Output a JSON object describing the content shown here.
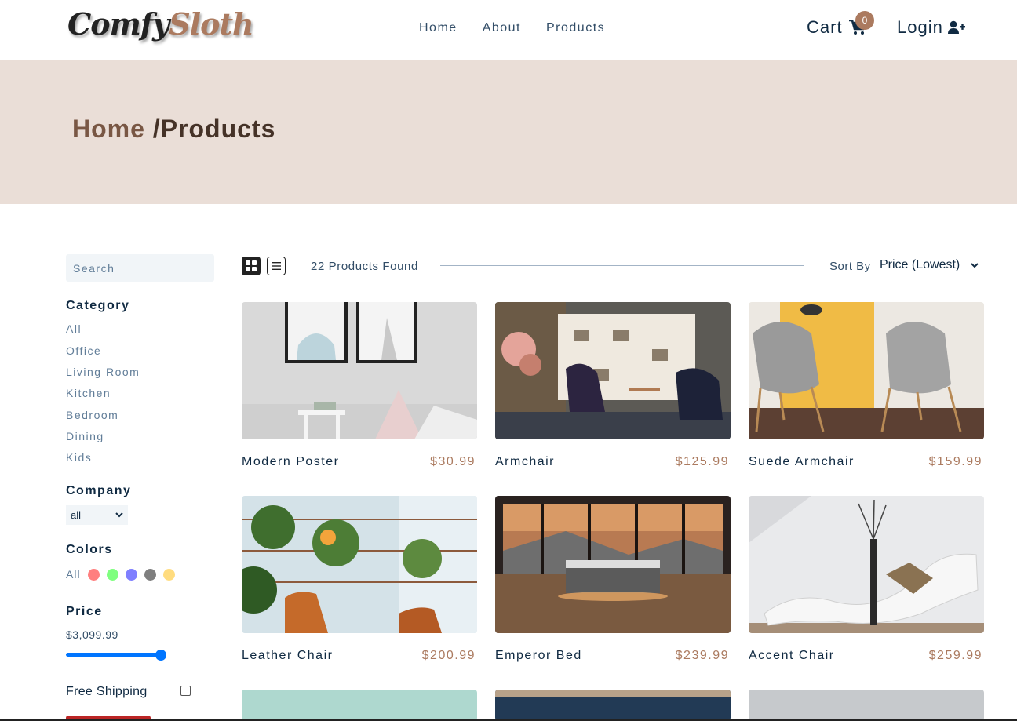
{
  "nav": {
    "logo_part1": "Comfy",
    "logo_part2": "Sloth",
    "links": [
      "Home",
      "About",
      "Products"
    ],
    "cart_label": "Cart",
    "cart_count": "0",
    "login_label": "Login"
  },
  "hero": {
    "crumb_home": "Home",
    "crumb_current": " /Products"
  },
  "filters": {
    "search_placeholder": "Search",
    "category_title": "Category",
    "categories": [
      "All",
      "Office",
      "Living Room",
      "Kitchen",
      "Bedroom",
      "Dining",
      "Kids"
    ],
    "company_title": "Company",
    "company_selected": "all",
    "colors_title": "Colors",
    "colors_all": "All",
    "colors": [
      "#ff0000",
      "#00ff00",
      "#0000ff",
      "#000000",
      "#ffb900"
    ],
    "price_title": "Price",
    "price_value": "$3,099.99",
    "free_shipping_label": "Free Shipping"
  },
  "toolbar": {
    "found": "22 Products Found",
    "sort_label": "Sort By",
    "sort_value": "Price (Lowest)"
  },
  "products": [
    {
      "name": "Modern Poster",
      "price": "$30.99"
    },
    {
      "name": "Armchair",
      "price": "$125.99"
    },
    {
      "name": "Suede Armchair",
      "price": "$159.99"
    },
    {
      "name": "Leather Chair",
      "price": "$200.99"
    },
    {
      "name": "Emperor Bed",
      "price": "$239.99"
    },
    {
      "name": "Accent Chair",
      "price": "$259.99"
    }
  ]
}
